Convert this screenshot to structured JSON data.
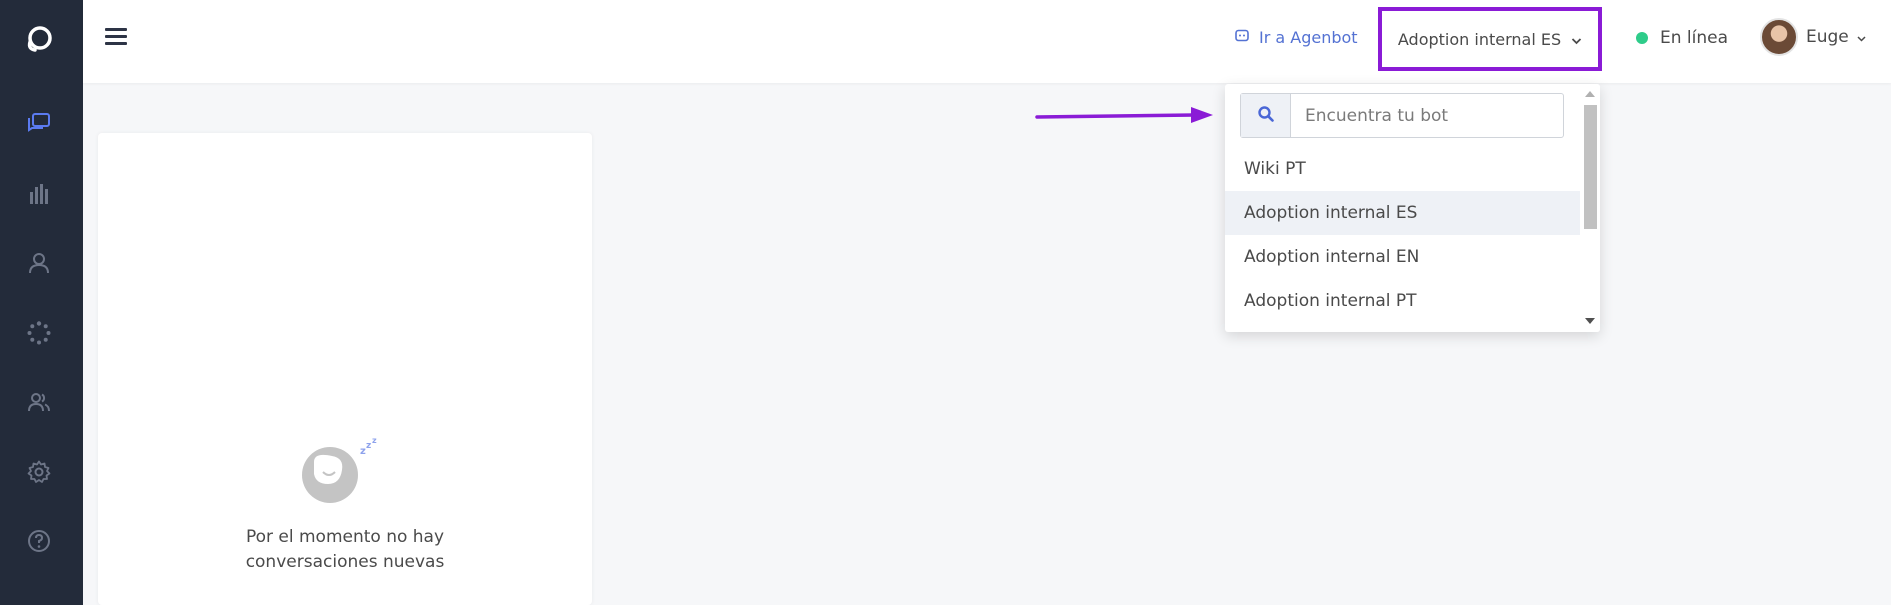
{
  "sidebar": {
    "items": [
      {
        "name": "sidebar-item-conversations",
        "icon": "chat-bubbles-icon",
        "active": true
      },
      {
        "name": "sidebar-item-analytics",
        "icon": "bar-chart-icon"
      },
      {
        "name": "sidebar-item-contacts",
        "icon": "user-icon"
      },
      {
        "name": "sidebar-item-integrations",
        "icon": "loader-dots-icon"
      },
      {
        "name": "sidebar-item-team",
        "icon": "users-icon"
      },
      {
        "name": "sidebar-item-settings",
        "icon": "gear-icon"
      },
      {
        "name": "sidebar-item-help",
        "icon": "question-circle-icon"
      }
    ]
  },
  "header": {
    "agenbot_link": "Ir a Agenbot",
    "bot_selector": "Adoption internal ES",
    "status": "En línea",
    "user_name": "Euge"
  },
  "dropdown": {
    "search_placeholder": "Encuentra tu bot",
    "items": [
      "Wiki PT",
      "Adoption internal ES",
      "Adoption internal EN",
      "Adoption internal PT"
    ],
    "selected_index": 1
  },
  "conversations_panel": {
    "empty_line1": "Por el momento no hay",
    "empty_line2": "conversaciones nuevas"
  },
  "colors": {
    "sidebar_bg": "#232b3a",
    "accent": "#5472d3",
    "highlight_border": "#8a1bd6",
    "status_online": "#2ecc8a"
  }
}
